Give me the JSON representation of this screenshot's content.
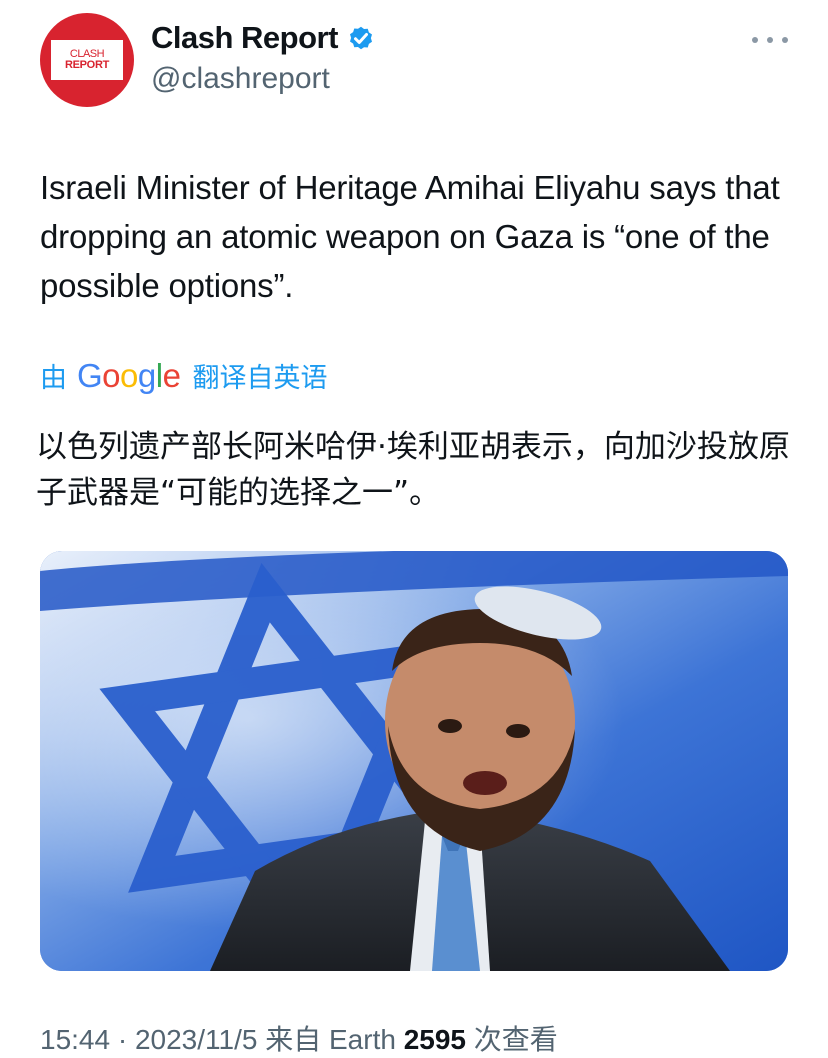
{
  "account": {
    "display_name": "Clash Report",
    "handle": "@clashreport",
    "avatar_text_line1": "CLASH",
    "avatar_text_line2": "REPORT"
  },
  "tweet": {
    "text": "Israeli Minister of Heritage Amihai Eliyahu says that dropping an atomic weapon on Gaza is “one of the possible options”.",
    "translation_prefix": "由",
    "translation_brand": "Google",
    "translation_suffix": "翻译自英语",
    "translated_text": "以色列遗产部长阿米哈伊·埃利亚胡表示，向加沙投放原子武器是“可能的选择之一”。"
  },
  "meta": {
    "time_date": "15:44 · 2023/11/5",
    "via": "来自 Earth",
    "views_count": "2595",
    "views_label": "次查看"
  },
  "colors": {
    "accent": "#1d9bf0",
    "brand_red": "#d8232f",
    "flag_blue": "#2a62c8"
  },
  "icons": [
    "verified-badge-icon",
    "more-options-icon"
  ]
}
